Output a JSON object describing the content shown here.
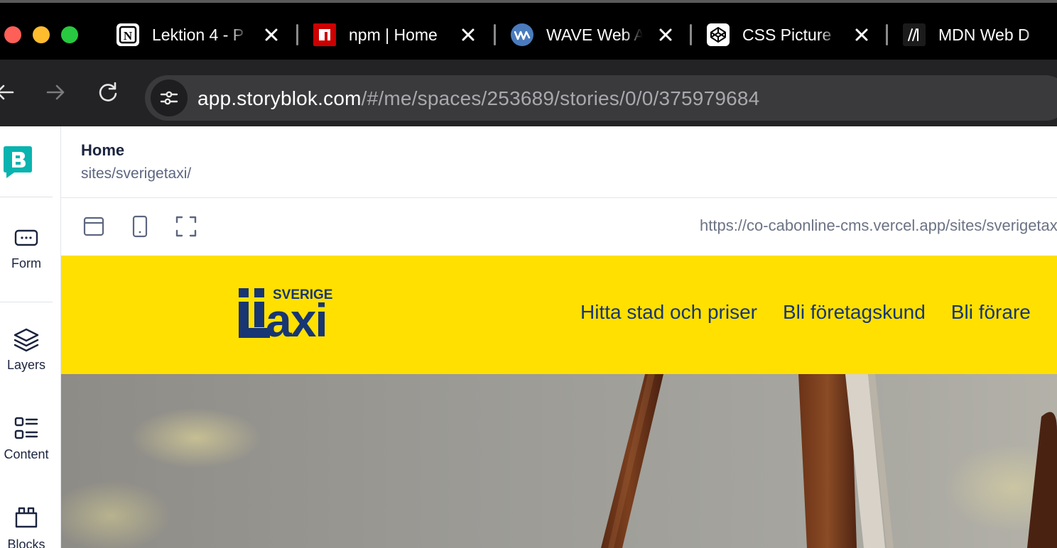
{
  "browser": {
    "tabs": [
      {
        "title": "Lektion 4 - P",
        "icon": "notion-icon"
      },
      {
        "title": "npm | Home",
        "icon": "npm-icon"
      },
      {
        "title": "WAVE Web A",
        "icon": "wave-icon"
      },
      {
        "title": "CSS Picture",
        "icon": "codepen-icon"
      },
      {
        "title": "MDN Web D",
        "icon": "mdn-icon"
      }
    ],
    "address": {
      "host": "app.storyblok.com",
      "path": "/#/me/spaces/253689/stories/0/0/375979684"
    }
  },
  "sidebar": {
    "items": [
      {
        "label": "Form",
        "icon": "form-icon"
      },
      {
        "label": "Layers",
        "icon": "layers-icon"
      },
      {
        "label": "Content",
        "icon": "content-icon"
      },
      {
        "label": "Blocks",
        "icon": "blocks-icon"
      }
    ]
  },
  "story": {
    "title": "Home",
    "path": "sites/sverigetaxi/"
  },
  "preview": {
    "url": "https://co-cabonline-cms.vercel.app/sites/sverigetaxi/"
  },
  "site": {
    "logo_text_top": "SVERIGE",
    "logo_text_main": "axi",
    "nav": [
      "Hitta stad och priser",
      "Bli företagskund",
      "Bli förare"
    ]
  },
  "colors": {
    "site_yellow": "#ffe000",
    "site_navy": "#173673",
    "storyblok_teal": "#09b3af"
  }
}
